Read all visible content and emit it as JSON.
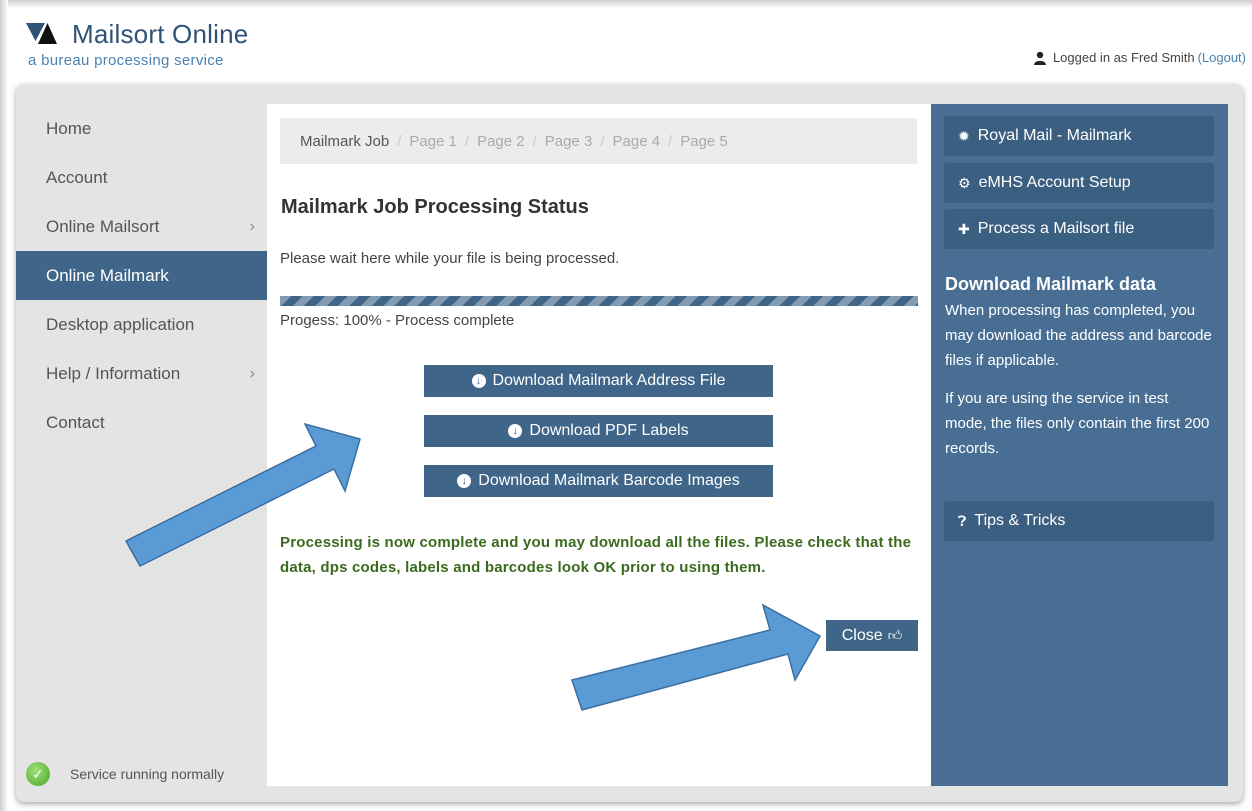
{
  "header": {
    "brand_title": "Mailsort Online",
    "brand_subtitle": "a bureau processing service",
    "logged_in_label": "Logged in as Fred Smith",
    "logout_label": "(Logout)"
  },
  "nav": {
    "items": [
      {
        "label": "Home"
      },
      {
        "label": "Account"
      },
      {
        "label": "Online Mailsort"
      },
      {
        "label": "Online Mailmark"
      },
      {
        "label": "Desktop application"
      },
      {
        "label": "Help / Information"
      },
      {
        "label": "Contact"
      }
    ],
    "active": "Online Mailmark"
  },
  "status": {
    "text": "Service running normally"
  },
  "breadcrumb": [
    "Mailmark Job",
    "Page 1",
    "Page 2",
    "Page 3",
    "Page 4",
    "Page 5"
  ],
  "main": {
    "title": "Mailmark Job Processing Status",
    "wait_text": "Please wait here while your file is being processed.",
    "progress_percent": 100,
    "progress_text": "Progess: 100% - Process complete",
    "buttons": {
      "address_file": "Download Mailmark Address File",
      "pdf_labels": "Download PDF Labels",
      "barcode_images": "Download Mailmark Barcode Images"
    },
    "complete_message": "Processing is now complete and you may download all the files. Please check that the data, dps codes, labels and barcodes look OK prior to using them.",
    "close_label": "Close"
  },
  "sidebar": {
    "buttons": {
      "royal_mail": "Royal Mail - Mailmark",
      "emhs": "eMHS Account Setup",
      "process": "Process a Mailsort file",
      "tips": "Tips & Tricks"
    },
    "download_heading": "Download Mailmark data",
    "download_text": "When processing has completed, you may download the address and barcode files if applicable.",
    "test_mode_text": "If you are using the service in test mode, the files only contain the first 200 records."
  },
  "colors": {
    "accent": "#3f6588",
    "sidebar": "#486f93",
    "success_text": "#3a6b1e",
    "arrow": "#5b9bd5"
  },
  "icons": {
    "download": "circle-arrow-down-icon",
    "close": "thumbs-up-icon",
    "royal_mail": "certificate-icon",
    "emhs": "gear-icon",
    "process": "plus-icon",
    "tips": "question-circle-icon",
    "user": "user-icon",
    "status": "check-circle-icon"
  }
}
